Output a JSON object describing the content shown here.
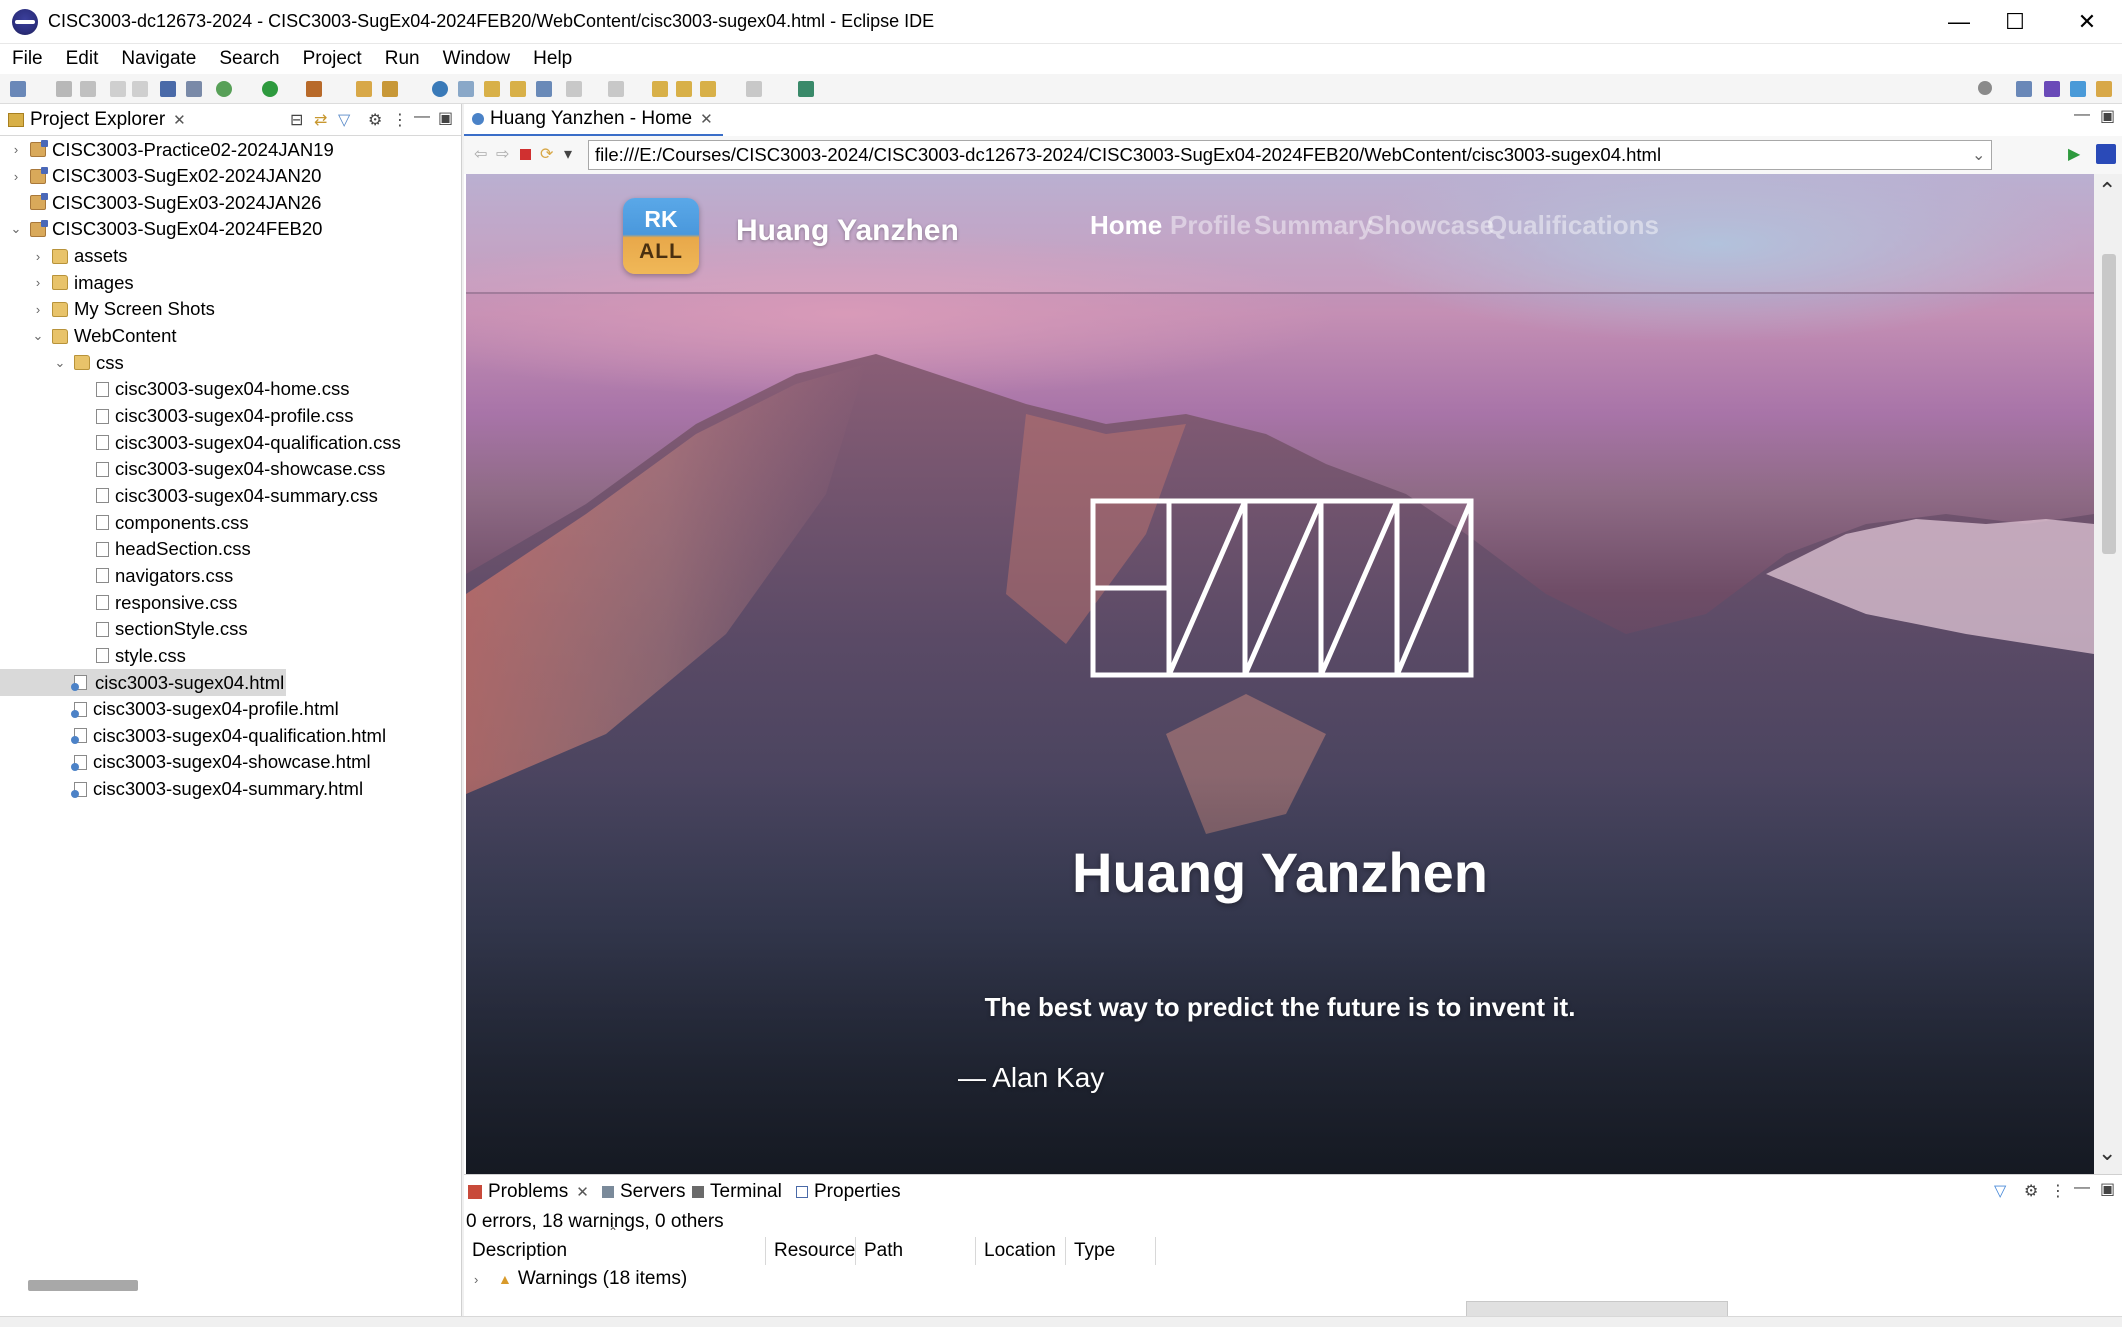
{
  "window": {
    "title": "CISC3003-dc12673-2024 - CISC3003-SugEx04-2024FEB20/WebContent/cisc3003-sugex04.html - Eclipse IDE",
    "minimize": "—",
    "maximize": "☐",
    "close": "✕"
  },
  "menu": [
    "File",
    "Edit",
    "Navigate",
    "Search",
    "Project",
    "Run",
    "Window",
    "Help"
  ],
  "explorer": {
    "tab_label": "Project Explorer",
    "tree": [
      {
        "label": "CISC3003-Practice02-2024JAN19",
        "type": "project",
        "twisty": "›",
        "indent": 0
      },
      {
        "label": "CISC3003-SugEx02-2024JAN20",
        "type": "project",
        "twisty": "›",
        "indent": 0
      },
      {
        "label": "CISC3003-SugEx03-2024JAN26",
        "type": "project",
        "twisty": "",
        "indent": 0
      },
      {
        "label": "CISC3003-SugEx04-2024FEB20",
        "type": "project",
        "twisty": "⌄",
        "indent": 0
      },
      {
        "label": "assets",
        "type": "folder",
        "twisty": "›",
        "indent": 1
      },
      {
        "label": "images",
        "type": "folder",
        "twisty": "›",
        "indent": 1
      },
      {
        "label": "My Screen Shots",
        "type": "folder",
        "twisty": "›",
        "indent": 1
      },
      {
        "label": "WebContent",
        "type": "folder",
        "twisty": "⌄",
        "indent": 1
      },
      {
        "label": "css",
        "type": "folder",
        "twisty": "⌄",
        "indent": 2
      },
      {
        "label": "cisc3003-sugex04-home.css",
        "type": "file",
        "twisty": "",
        "indent": 3
      },
      {
        "label": "cisc3003-sugex04-profile.css",
        "type": "file",
        "twisty": "",
        "indent": 3
      },
      {
        "label": "cisc3003-sugex04-qualification.css",
        "type": "file",
        "twisty": "",
        "indent": 3
      },
      {
        "label": "cisc3003-sugex04-showcase.css",
        "type": "file",
        "twisty": "",
        "indent": 3
      },
      {
        "label": "cisc3003-sugex04-summary.css",
        "type": "file",
        "twisty": "",
        "indent": 3
      },
      {
        "label": "components.css",
        "type": "file",
        "twisty": "",
        "indent": 3
      },
      {
        "label": "headSection.css",
        "type": "file",
        "twisty": "",
        "indent": 3
      },
      {
        "label": "navigators.css",
        "type": "file",
        "twisty": "",
        "indent": 3
      },
      {
        "label": "responsive.css",
        "type": "file",
        "twisty": "",
        "indent": 3
      },
      {
        "label": "sectionStyle.css",
        "type": "file",
        "twisty": "",
        "indent": 3
      },
      {
        "label": "style.css",
        "type": "file",
        "twisty": "",
        "indent": 3
      },
      {
        "label": "cisc3003-sugex04.html",
        "type": "html",
        "twisty": "",
        "indent": 2,
        "selected": true
      },
      {
        "label": "cisc3003-sugex04-profile.html",
        "type": "html",
        "twisty": "",
        "indent": 2
      },
      {
        "label": "cisc3003-sugex04-qualification.html",
        "type": "html",
        "twisty": "",
        "indent": 2
      },
      {
        "label": "cisc3003-sugex04-showcase.html",
        "type": "html",
        "twisty": "",
        "indent": 2
      },
      {
        "label": "cisc3003-sugex04-summary.html",
        "type": "html",
        "twisty": "",
        "indent": 2
      }
    ]
  },
  "editor": {
    "tab_label": "Huang Yanzhen - Home",
    "url": "file:///E:/Courses/CISC3003-2024/CISC3003-dc12673-2024/CISC3003-SugEx04-2024FEB20/WebContent/cisc3003-sugex04.html"
  },
  "site": {
    "logo_top": "RK",
    "logo_bottom": "ALL",
    "brand": "Huang Yanzhen",
    "nav": [
      "Home",
      "Profile",
      "Summary",
      "Showcase",
      "Qualifications"
    ],
    "active_nav": "Home",
    "hero_name": "Huang Yanzhen",
    "quote": "The best way to predict the future is to invent it.",
    "author": "— Alan Kay"
  },
  "problems": {
    "tabs": [
      "Problems",
      "Servers",
      "Terminal",
      "Properties"
    ],
    "summary": "0 errors, 18 warnings, 0 others",
    "columns": [
      "Description",
      "Resource",
      "Path",
      "Location",
      "Type"
    ],
    "rows": [
      {
        "label": "Warnings (18 items)"
      }
    ]
  },
  "colors": {
    "accent": "#3a6ec8",
    "selection": "#d9d9d9",
    "nav_inactive": "rgba(255,255,255,0.45)"
  }
}
